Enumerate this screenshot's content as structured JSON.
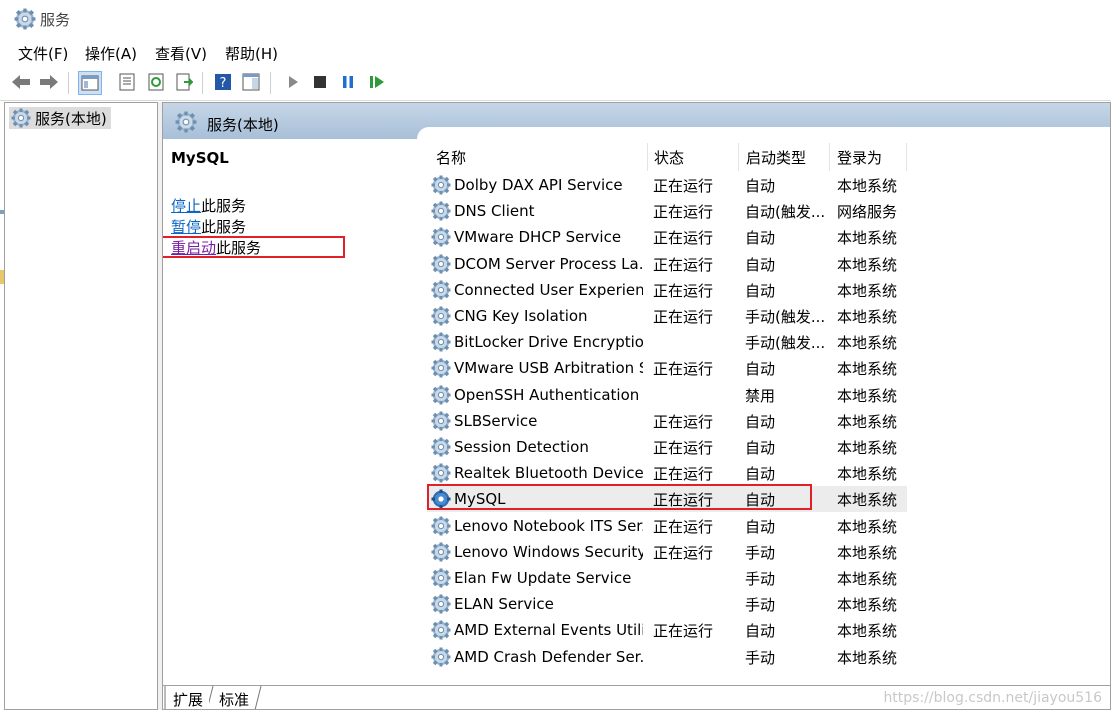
{
  "window": {
    "title": "服务"
  },
  "menu": [
    "文件(F)",
    "操作(A)",
    "查看(V)",
    "帮助(H)"
  ],
  "tree": {
    "root_label": "服务(本地)"
  },
  "pane": {
    "title": "服务(本地)"
  },
  "detail": {
    "service_name": "MySQL",
    "actions": [
      {
        "link": "停止",
        "rest": "此服务"
      },
      {
        "link": "暂停",
        "rest": "此服务"
      },
      {
        "link": "重启动",
        "rest": "此服务"
      }
    ]
  },
  "table": {
    "headers": [
      "名称",
      "状态",
      "启动类型",
      "登录为"
    ],
    "rows": [
      {
        "name": "Dolby DAX API Service",
        "status": "正在运行",
        "type": "自动",
        "logon": "本地系统"
      },
      {
        "name": "DNS Client",
        "status": "正在运行",
        "type": "自动(触发...",
        "logon": "网络服务"
      },
      {
        "name": "VMware DHCP Service",
        "status": "正在运行",
        "type": "自动",
        "logon": "本地系统"
      },
      {
        "name": "DCOM Server Process La...",
        "status": "正在运行",
        "type": "自动",
        "logon": "本地系统"
      },
      {
        "name": "Connected User Experien...",
        "status": "正在运行",
        "type": "自动",
        "logon": "本地系统"
      },
      {
        "name": "CNG Key Isolation",
        "status": "正在运行",
        "type": "手动(触发...",
        "logon": "本地系统"
      },
      {
        "name": "BitLocker Drive Encryptio...",
        "status": "",
        "type": "手动(触发...",
        "logon": "本地系统"
      },
      {
        "name": "VMware USB Arbitration S...",
        "status": "正在运行",
        "type": "自动",
        "logon": "本地系统"
      },
      {
        "name": "OpenSSH Authentication ...",
        "status": "",
        "type": "禁用",
        "logon": "本地系统"
      },
      {
        "name": "SLBService",
        "status": "正在运行",
        "type": "自动",
        "logon": "本地系统"
      },
      {
        "name": "Session Detection",
        "status": "正在运行",
        "type": "自动",
        "logon": "本地系统"
      },
      {
        "name": "Realtek Bluetooth Device ...",
        "status": "正在运行",
        "type": "自动",
        "logon": "本地系统"
      },
      {
        "name": "MySQL",
        "status": "正在运行",
        "type": "自动",
        "logon": "本地系统"
      },
      {
        "name": "Lenovo Notebook ITS Ser...",
        "status": "正在运行",
        "type": "自动",
        "logon": "本地系统"
      },
      {
        "name": "Lenovo Windows Security...",
        "status": "正在运行",
        "type": "手动",
        "logon": "本地系统"
      },
      {
        "name": "Elan Fw Update Service",
        "status": "",
        "type": "手动",
        "logon": "本地系统"
      },
      {
        "name": "ELAN Service",
        "status": "",
        "type": "手动",
        "logon": "本地系统"
      },
      {
        "name": "AMD External Events Utility",
        "status": "正在运行",
        "type": "自动",
        "logon": "本地系统"
      },
      {
        "name": "AMD Crash Defender Ser...",
        "status": "",
        "type": "手动",
        "logon": "本地系统"
      }
    ]
  },
  "tabs": [
    "扩展",
    "标准"
  ],
  "watermark": "https://blog.csdn.net/jiayou516",
  "icons": {
    "app": "gear-icon",
    "back": "back-arrow-icon",
    "forward": "forward-arrow-icon",
    "play": "play-icon",
    "stop": "stop-icon",
    "pause": "pause-icon",
    "restart": "restart-icon"
  },
  "colors": {
    "highlight_box": "#e2202a",
    "link": "#0a66c2",
    "visited_link": "#7a1fa2",
    "header_bg": "#b5c9de"
  }
}
